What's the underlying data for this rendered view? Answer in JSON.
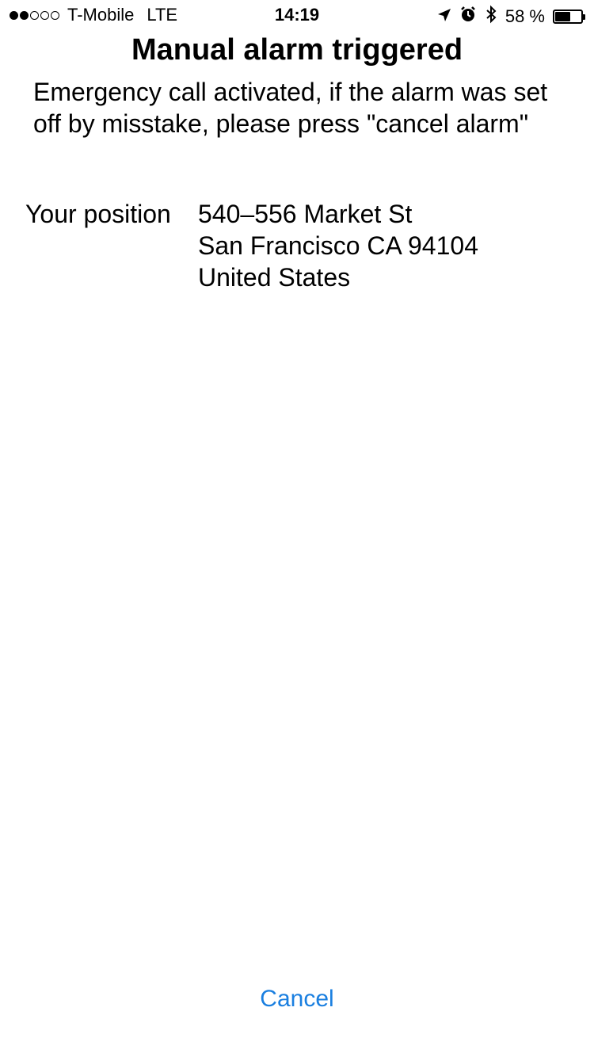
{
  "status_bar": {
    "signal_filled": 2,
    "signal_total": 5,
    "carrier": "T-Mobile",
    "network": "LTE",
    "time": "14:19",
    "battery_text": "58 %",
    "battery_level": 0.58,
    "icons": [
      "location-arrow-icon",
      "alarm-clock-icon",
      "bluetooth-icon"
    ]
  },
  "alarm": {
    "title": "Manual alarm triggered",
    "message": "Emergency call activated, if the alarm was set off by misstake, please press \"cancel alarm\""
  },
  "position": {
    "label": "Your position",
    "address_lines": [
      "540–556 Market St",
      "San Francisco CA 94104",
      "United States"
    ]
  },
  "actions": {
    "cancel_label": "Cancel"
  },
  "colors": {
    "accent": "#1a7fe0",
    "background": "#ffffff",
    "text": "#000000"
  }
}
